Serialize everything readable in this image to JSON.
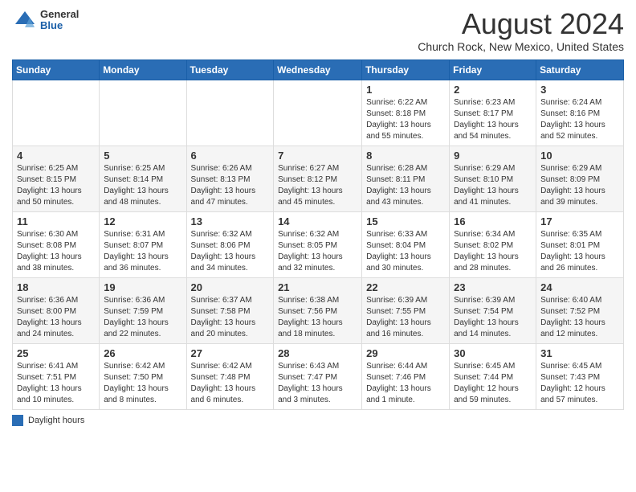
{
  "header": {
    "logo_general": "General",
    "logo_blue": "Blue",
    "month_title": "August 2024",
    "location": "Church Rock, New Mexico, United States"
  },
  "footer": {
    "legend_label": "Daylight hours"
  },
  "weekdays": [
    "Sunday",
    "Monday",
    "Tuesday",
    "Wednesday",
    "Thursday",
    "Friday",
    "Saturday"
  ],
  "weeks": [
    [
      {
        "day": "",
        "info": ""
      },
      {
        "day": "",
        "info": ""
      },
      {
        "day": "",
        "info": ""
      },
      {
        "day": "",
        "info": ""
      },
      {
        "day": "1",
        "info": "Sunrise: 6:22 AM\nSunset: 8:18 PM\nDaylight: 13 hours\nand 55 minutes."
      },
      {
        "day": "2",
        "info": "Sunrise: 6:23 AM\nSunset: 8:17 PM\nDaylight: 13 hours\nand 54 minutes."
      },
      {
        "day": "3",
        "info": "Sunrise: 6:24 AM\nSunset: 8:16 PM\nDaylight: 13 hours\nand 52 minutes."
      }
    ],
    [
      {
        "day": "4",
        "info": "Sunrise: 6:25 AM\nSunset: 8:15 PM\nDaylight: 13 hours\nand 50 minutes."
      },
      {
        "day": "5",
        "info": "Sunrise: 6:25 AM\nSunset: 8:14 PM\nDaylight: 13 hours\nand 48 minutes."
      },
      {
        "day": "6",
        "info": "Sunrise: 6:26 AM\nSunset: 8:13 PM\nDaylight: 13 hours\nand 47 minutes."
      },
      {
        "day": "7",
        "info": "Sunrise: 6:27 AM\nSunset: 8:12 PM\nDaylight: 13 hours\nand 45 minutes."
      },
      {
        "day": "8",
        "info": "Sunrise: 6:28 AM\nSunset: 8:11 PM\nDaylight: 13 hours\nand 43 minutes."
      },
      {
        "day": "9",
        "info": "Sunrise: 6:29 AM\nSunset: 8:10 PM\nDaylight: 13 hours\nand 41 minutes."
      },
      {
        "day": "10",
        "info": "Sunrise: 6:29 AM\nSunset: 8:09 PM\nDaylight: 13 hours\nand 39 minutes."
      }
    ],
    [
      {
        "day": "11",
        "info": "Sunrise: 6:30 AM\nSunset: 8:08 PM\nDaylight: 13 hours\nand 38 minutes."
      },
      {
        "day": "12",
        "info": "Sunrise: 6:31 AM\nSunset: 8:07 PM\nDaylight: 13 hours\nand 36 minutes."
      },
      {
        "day": "13",
        "info": "Sunrise: 6:32 AM\nSunset: 8:06 PM\nDaylight: 13 hours\nand 34 minutes."
      },
      {
        "day": "14",
        "info": "Sunrise: 6:32 AM\nSunset: 8:05 PM\nDaylight: 13 hours\nand 32 minutes."
      },
      {
        "day": "15",
        "info": "Sunrise: 6:33 AM\nSunset: 8:04 PM\nDaylight: 13 hours\nand 30 minutes."
      },
      {
        "day": "16",
        "info": "Sunrise: 6:34 AM\nSunset: 8:02 PM\nDaylight: 13 hours\nand 28 minutes."
      },
      {
        "day": "17",
        "info": "Sunrise: 6:35 AM\nSunset: 8:01 PM\nDaylight: 13 hours\nand 26 minutes."
      }
    ],
    [
      {
        "day": "18",
        "info": "Sunrise: 6:36 AM\nSunset: 8:00 PM\nDaylight: 13 hours\nand 24 minutes."
      },
      {
        "day": "19",
        "info": "Sunrise: 6:36 AM\nSunset: 7:59 PM\nDaylight: 13 hours\nand 22 minutes."
      },
      {
        "day": "20",
        "info": "Sunrise: 6:37 AM\nSunset: 7:58 PM\nDaylight: 13 hours\nand 20 minutes."
      },
      {
        "day": "21",
        "info": "Sunrise: 6:38 AM\nSunset: 7:56 PM\nDaylight: 13 hours\nand 18 minutes."
      },
      {
        "day": "22",
        "info": "Sunrise: 6:39 AM\nSunset: 7:55 PM\nDaylight: 13 hours\nand 16 minutes."
      },
      {
        "day": "23",
        "info": "Sunrise: 6:39 AM\nSunset: 7:54 PM\nDaylight: 13 hours\nand 14 minutes."
      },
      {
        "day": "24",
        "info": "Sunrise: 6:40 AM\nSunset: 7:52 PM\nDaylight: 13 hours\nand 12 minutes."
      }
    ],
    [
      {
        "day": "25",
        "info": "Sunrise: 6:41 AM\nSunset: 7:51 PM\nDaylight: 13 hours\nand 10 minutes."
      },
      {
        "day": "26",
        "info": "Sunrise: 6:42 AM\nSunset: 7:50 PM\nDaylight: 13 hours\nand 8 minutes."
      },
      {
        "day": "27",
        "info": "Sunrise: 6:42 AM\nSunset: 7:48 PM\nDaylight: 13 hours\nand 6 minutes."
      },
      {
        "day": "28",
        "info": "Sunrise: 6:43 AM\nSunset: 7:47 PM\nDaylight: 13 hours\nand 3 minutes."
      },
      {
        "day": "29",
        "info": "Sunrise: 6:44 AM\nSunset: 7:46 PM\nDaylight: 13 hours\nand 1 minute."
      },
      {
        "day": "30",
        "info": "Sunrise: 6:45 AM\nSunset: 7:44 PM\nDaylight: 12 hours\nand 59 minutes."
      },
      {
        "day": "31",
        "info": "Sunrise: 6:45 AM\nSunset: 7:43 PM\nDaylight: 12 hours\nand 57 minutes."
      }
    ]
  ]
}
